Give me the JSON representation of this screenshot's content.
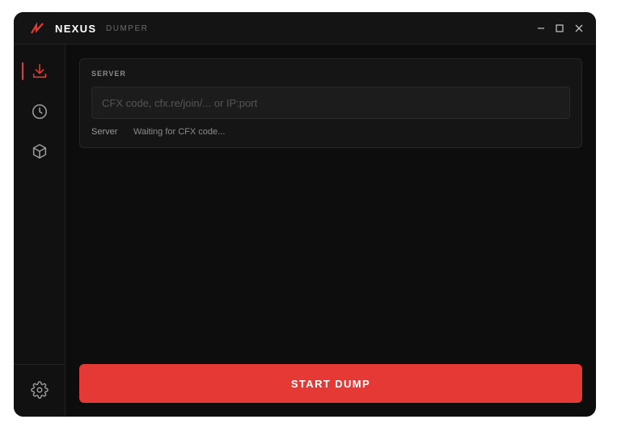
{
  "app": {
    "name": "NEXUS",
    "subtitle": "DUMPER",
    "accent_color": "#e53935"
  },
  "titlebar": {
    "controls": [
      "minimize-icon",
      "maximize-icon",
      "close-icon"
    ]
  },
  "sidebar": {
    "items": [
      {
        "icon": "download-icon",
        "active": true
      },
      {
        "icon": "clock-icon",
        "active": false
      },
      {
        "icon": "box-icon",
        "active": false
      }
    ],
    "footer_icon": "gear-icon"
  },
  "server_card": {
    "label": "SERVER",
    "input_value": "",
    "input_placeholder": "CFX code, cfx.re/join/... or IP:port",
    "status_label": "Server",
    "status_value": "Waiting for CFX code..."
  },
  "actions": {
    "start_label": "START DUMP"
  }
}
